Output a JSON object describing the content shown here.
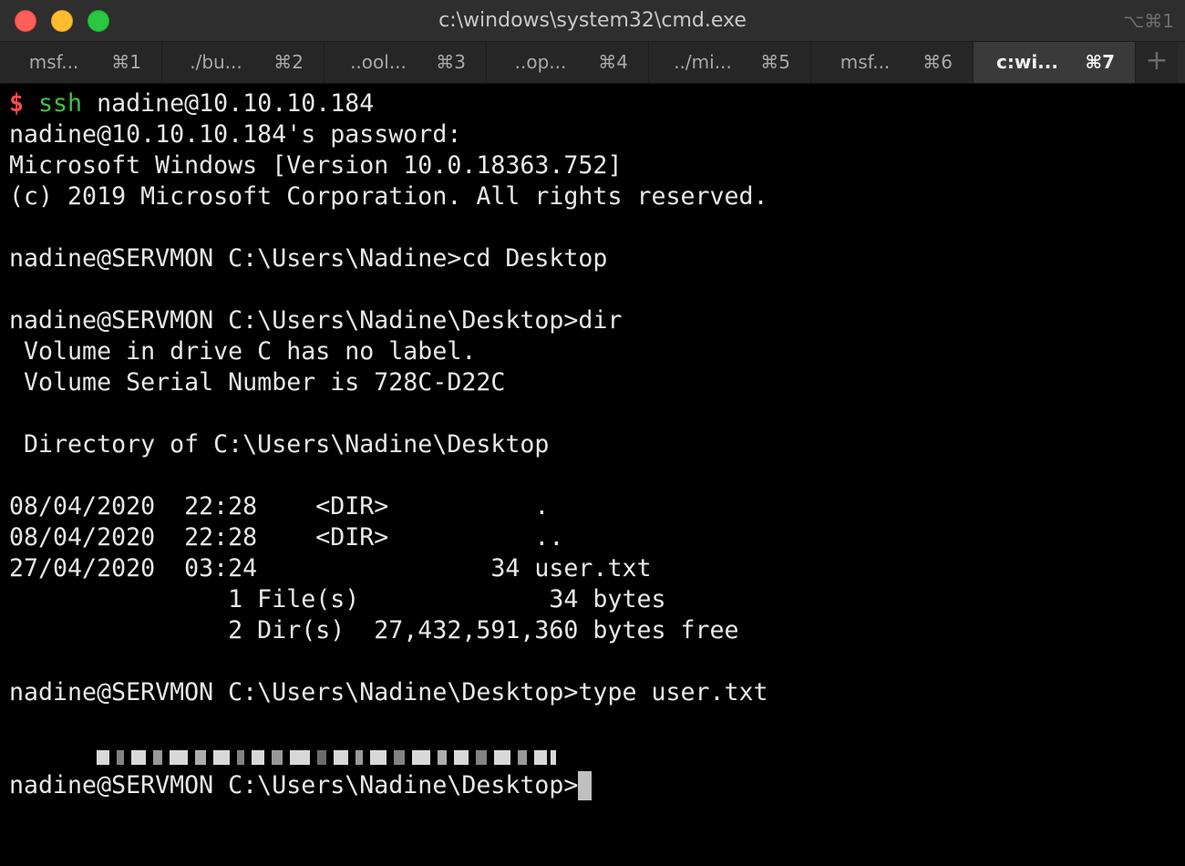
{
  "window": {
    "title": "c:\\windows\\system32\\cmd.exe",
    "title_shortcut": "⌥⌘1",
    "traffic_lights": {
      "close": "#fe5f57",
      "minimize": "#febc2e",
      "maximize": "#28c840"
    }
  },
  "tabs": [
    {
      "label": "msf...",
      "shortcut": "⌘1",
      "active": false
    },
    {
      "label": "./bu...",
      "shortcut": "⌘2",
      "active": false
    },
    {
      "label": "..ool...",
      "shortcut": "⌘3",
      "active": false
    },
    {
      "label": "..op...",
      "shortcut": "⌘4",
      "active": false
    },
    {
      "label": "../mi...",
      "shortcut": "⌘5",
      "active": false
    },
    {
      "label": "msf...",
      "shortcut": "⌘6",
      "active": false
    },
    {
      "label": "c:wi...",
      "shortcut": "⌘7",
      "active": true
    }
  ],
  "new_tab_icon": "plus-icon",
  "terminal": {
    "prompt_symbol": "$",
    "ssh_command": "ssh",
    "ssh_target": "nadine@10.10.10.184",
    "lines": [
      "nadine@10.10.10.184's password:",
      "Microsoft Windows [Version 10.0.18363.752]",
      "(c) 2019 Microsoft Corporation. All rights reserved.",
      "",
      "nadine@SERVMON C:\\Users\\Nadine>cd Desktop",
      "",
      "nadine@SERVMON C:\\Users\\Nadine\\Desktop>dir",
      " Volume in drive C has no label.",
      " Volume Serial Number is 728C-D22C",
      "",
      " Directory of C:\\Users\\Nadine\\Desktop",
      "",
      "08/04/2020  22:28    <DIR>          .",
      "08/04/2020  22:28    <DIR>          ..",
      "27/04/2020  03:24                34 user.txt",
      "               1 File(s)             34 bytes",
      "               2 Dir(s)  27,432,591,360 bytes free",
      "",
      "nadine@SERVMON C:\\Users\\Nadine\\Desktop>type user.txt"
    ],
    "final_prompt": "nadine@SERVMON C:\\Users\\Nadine\\Desktop>",
    "colors": {
      "background": "#000000",
      "foreground": "#e8e8e8",
      "prompt_dollar": "#ff4b4b",
      "ssh_command": "#3fc23f"
    }
  }
}
